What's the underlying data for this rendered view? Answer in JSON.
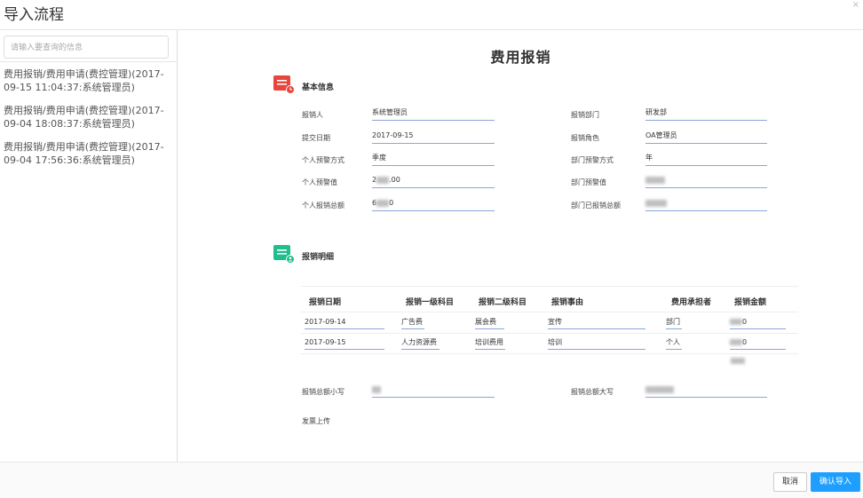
{
  "window": {
    "title": "导入流程",
    "close_glyph": "×"
  },
  "sidebar": {
    "search_placeholder": "请输入要查询的信息",
    "items": [
      {
        "line1": "费用报销/费用申请(费控管理)(2017-",
        "line2": "09-15 11:04:37:系统管理员)"
      },
      {
        "line1": "费用报销/费用申请(费控管理)(2017-",
        "line2": "09-04 18:08:37:系统管理员)"
      },
      {
        "line1": "费用报销/费用申请(费控管理)(2017-",
        "line2": "09-04 17:56:36:系统管理员)"
      }
    ]
  },
  "form": {
    "title": "费用报销",
    "basic_section": {
      "title": "基本信息",
      "icon": "document-clock-icon",
      "icon_color": "#e8453c",
      "fields": {
        "applicant_label": "报销人",
        "applicant_value": "系统管理员",
        "dept_label": "报销部门",
        "dept_value": "研发部",
        "date_label": "提交日期",
        "date_value": "2017-09-15",
        "role_label": "报销角色",
        "role_value": "OA管理员",
        "personal_budget_mode_label": "个人预警方式",
        "personal_budget_mode_value": "季度",
        "dept_budget_mode_label": "部门预警方式",
        "dept_budget_mode_value": "年",
        "personal_budget_label": "个人预警值",
        "personal_budget_value_prefix": "2",
        "personal_budget_value_suffix": ".00",
        "dept_budget_label": "部门预警值",
        "personal_total_label": "个人报销总额",
        "personal_total_value_prefix": "6",
        "personal_total_value_suffix": "0",
        "dept_total_label": "部门已报销总额"
      }
    },
    "detail_section": {
      "title": "报销明细",
      "icon": "document-user-icon",
      "icon_color": "#1fbe8c",
      "columns": [
        "报销日期",
        "报销一级科目",
        "报销二级科目",
        "报销事由",
        "费用承担者",
        "报销金额"
      ],
      "rows": [
        {
          "date": "2017-09-14",
          "level1": "广告费",
          "level2": "展会费",
          "reason": "宣传",
          "bearer": "部门",
          "amount_suffix": "0"
        },
        {
          "date": "2017-09-15",
          "level1": "人力资源费",
          "level2": "培训费用",
          "reason": "培训",
          "bearer": "个人",
          "amount_suffix": "0"
        }
      ]
    },
    "total_small_label": "报销总额小写",
    "total_big_label": "报销总额大写",
    "invoice_label": "发票上传"
  },
  "footer": {
    "cancel_label": "取消",
    "confirm_label": "确认导入"
  },
  "colors": {
    "accent": "#1e9fff",
    "underline": "#8aa6d6"
  }
}
